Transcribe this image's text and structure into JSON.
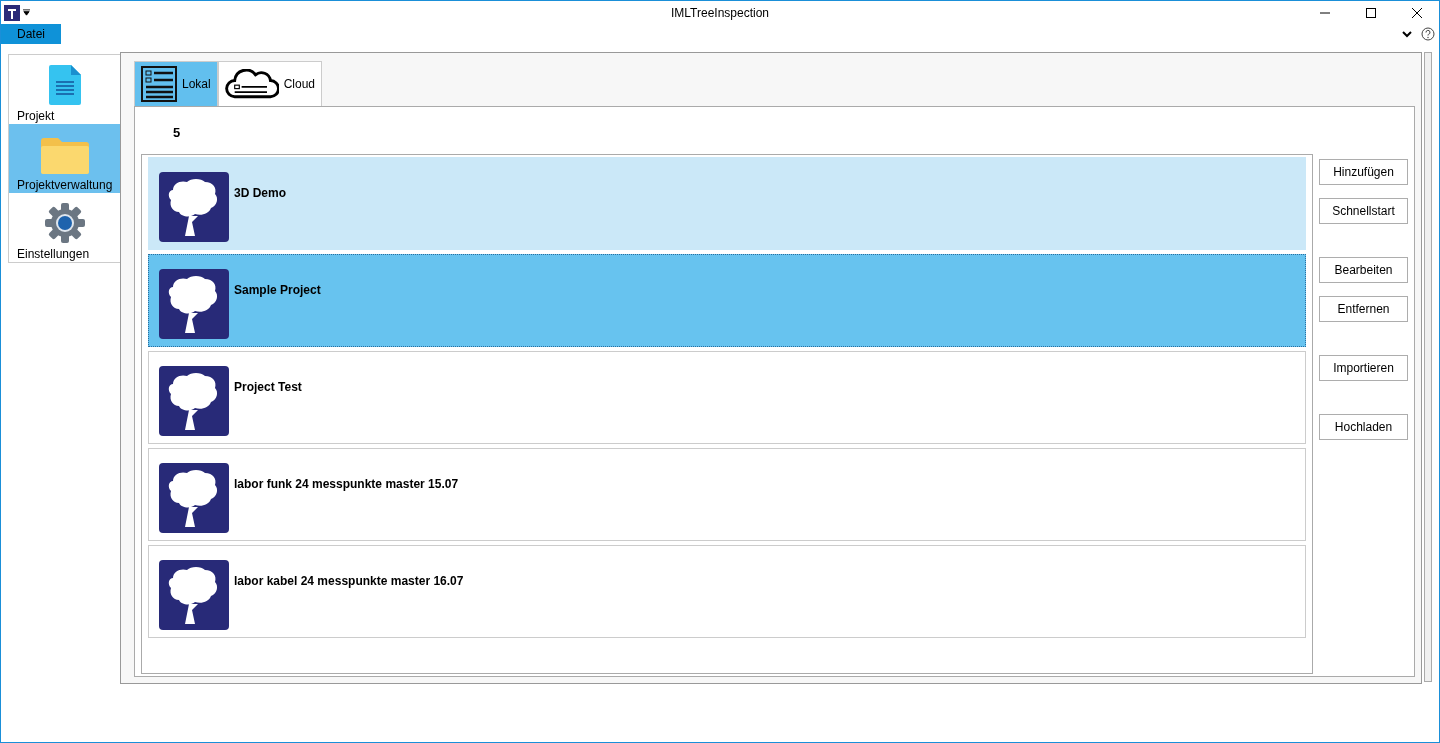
{
  "window": {
    "title": "IMLTreeInspection"
  },
  "menu": [
    {
      "label": "Datei",
      "selected": true
    }
  ],
  "sidebar": {
    "items": [
      {
        "label": "Projekt",
        "kind": "document",
        "selected": false
      },
      {
        "label": "Projektverwaltung",
        "kind": "folder",
        "selected": true
      },
      {
        "label": "Einstellungen",
        "kind": "gear",
        "selected": false
      }
    ]
  },
  "tabs": [
    {
      "label": "Lokal",
      "kind": "list",
      "selected": true
    },
    {
      "label": "Cloud",
      "kind": "cloud",
      "selected": false
    }
  ],
  "count": "5",
  "projects": [
    {
      "name": "3D Demo",
      "hovered": true,
      "selected": false
    },
    {
      "name": "Sample Project",
      "hovered": false,
      "selected": true
    },
    {
      "name": "Project Test",
      "hovered": false,
      "selected": false
    },
    {
      "name": "labor funk 24 messpunkte master 15.07",
      "hovered": false,
      "selected": false
    },
    {
      "name": "labor kabel 24 messpunkte master 16.07",
      "hovered": false,
      "selected": false
    }
  ],
  "button_groups": [
    [
      "Hinzufügen",
      "Schnellstart"
    ],
    [
      "Bearbeiten",
      "Entfernen"
    ],
    [
      "Importieren"
    ],
    [
      "Hochladen"
    ]
  ]
}
